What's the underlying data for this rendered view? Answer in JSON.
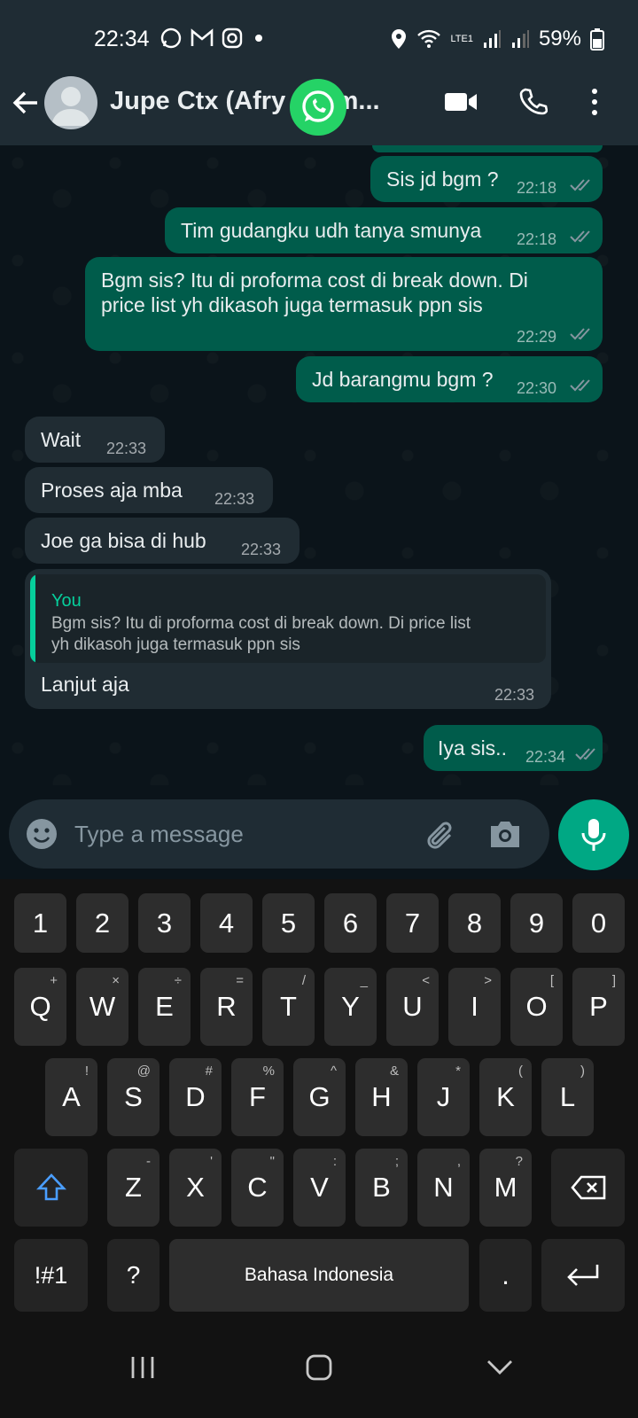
{
  "status": {
    "time": "22:34",
    "battery": "59%",
    "network": "LTE1"
  },
  "header": {
    "contact_name": "Jupe Ctx (Afry Surm..."
  },
  "messages": [
    {
      "text": "Sis jd bgm ?",
      "time": "22:18"
    },
    {
      "text": "Tim gudangku udh tanya smunya",
      "time": "22:18"
    },
    {
      "line1": "Bgm sis? Itu di proforma cost di break down. Di",
      "line2": "price list yh dikasoh juga termasuk ppn sis",
      "time": "22:29"
    },
    {
      "text": "Jd barangmu bgm ?",
      "time": "22:30"
    },
    {
      "text": "Wait",
      "time": "22:33"
    },
    {
      "text": "Proses aja mba",
      "time": "22:33"
    },
    {
      "text": "Joe ga bisa di hub",
      "time": "22:33"
    },
    {
      "quote_author": "You",
      "quote_line1": "Bgm sis? Itu di proforma cost di break down. Di price list",
      "quote_line2": "yh dikasoh juga termasuk ppn sis",
      "text": "Lanjut aja",
      "time": "22:33"
    },
    {
      "text": "Iya sis..",
      "time": "22:34"
    }
  ],
  "composer": {
    "placeholder": "Type a message"
  },
  "keyboard": {
    "numbers": [
      "1",
      "2",
      "3",
      "4",
      "5",
      "6",
      "7",
      "8",
      "9",
      "0"
    ],
    "row1": [
      {
        "k": "Q",
        "s": "+"
      },
      {
        "k": "W",
        "s": "×"
      },
      {
        "k": "E",
        "s": "÷"
      },
      {
        "k": "R",
        "s": "="
      },
      {
        "k": "T",
        "s": "/"
      },
      {
        "k": "Y",
        "s": "_"
      },
      {
        "k": "U",
        "s": "<"
      },
      {
        "k": "I",
        "s": ">"
      },
      {
        "k": "O",
        "s": "["
      },
      {
        "k": "P",
        "s": "]"
      }
    ],
    "row2": [
      {
        "k": "A",
        "s": "!"
      },
      {
        "k": "S",
        "s": "@"
      },
      {
        "k": "D",
        "s": "#"
      },
      {
        "k": "F",
        "s": "%"
      },
      {
        "k": "G",
        "s": "^"
      },
      {
        "k": "H",
        "s": "&"
      },
      {
        "k": "J",
        "s": "*"
      },
      {
        "k": "K",
        "s": "("
      },
      {
        "k": "L",
        "s": ")"
      }
    ],
    "row3": [
      {
        "k": "Z",
        "s": "-"
      },
      {
        "k": "X",
        "s": "'"
      },
      {
        "k": "C",
        "s": "\""
      },
      {
        "k": "V",
        "s": ":"
      },
      {
        "k": "B",
        "s": ";"
      },
      {
        "k": "N",
        "s": ","
      },
      {
        "k": "M",
        "s": "?"
      }
    ],
    "symbols_label": "!#1",
    "question_label": "?",
    "space_label": "Bahasa Indonesia",
    "period_label": "."
  },
  "colors": {
    "outgoing": "#005c4b",
    "incoming": "#202c33",
    "accent": "#00a884",
    "tick": "#8696a0"
  }
}
